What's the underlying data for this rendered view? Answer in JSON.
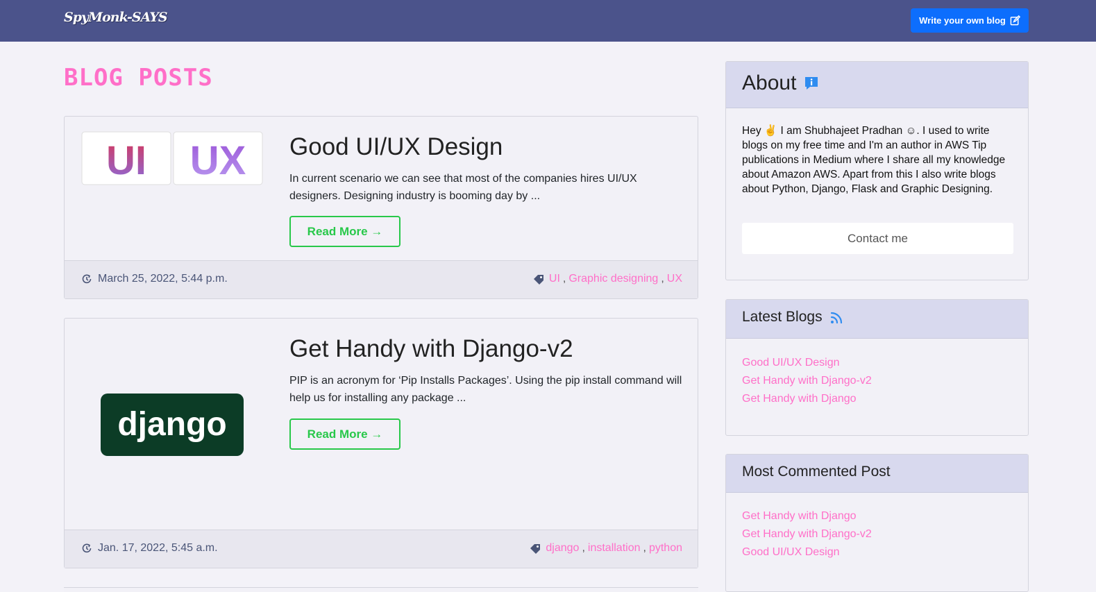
{
  "navbar": {
    "brand": "SpyMonk-SAYS",
    "write_button": "Write your own blog",
    "accent": "#4b538b"
  },
  "page": {
    "title": "BLOG POSTS",
    "title_color": "#ff6fc8"
  },
  "posts": [
    {
      "title": "Good UI/UX Design",
      "excerpt": "In current scenario we can see that most of the companies hires UI/UX designers. Designing industry is booming day by ...",
      "read_more": "Read More →",
      "date": "March 25, 2022, 5:44 p.m.",
      "tags": [
        "UI",
        "Graphic designing",
        "UX"
      ],
      "thumb": {
        "left": "UI",
        "right": "UX"
      }
    },
    {
      "title": "Get Handy with Django-v2",
      "excerpt": "PIP is an acronym for ‘Pip Installs Packages’. Using the pip install command will help us for installing any package ...",
      "read_more": "Read More →",
      "date": "Jan. 17, 2022, 5:45 a.m.",
      "tags": [
        "django",
        "installation",
        "python"
      ],
      "thumb": {
        "text": "django"
      }
    }
  ],
  "sidebar": {
    "about": {
      "title": "About",
      "text": "Hey ✌ I am Shubhajeet Pradhan ☺. I used to write blogs on my free time and I'm an author in AWS Tip publications in Medium where I share all my knowledge about Amazon AWS. Apart from this I also write blogs about Python, Django, Flask and Graphic Designing.",
      "contact": "Contact me"
    },
    "latest": {
      "title": "Latest Blogs",
      "items": [
        "Good UI/UX Design",
        "Get Handy with Django-v2",
        "Get Handy with Django"
      ]
    },
    "most_commented": {
      "title": "Most Commented Post",
      "items": [
        "Get Handy with Django",
        "Get Handy with Django-v2",
        "Good UI/UX Design"
      ]
    }
  },
  "separators": {
    "comma": ","
  }
}
